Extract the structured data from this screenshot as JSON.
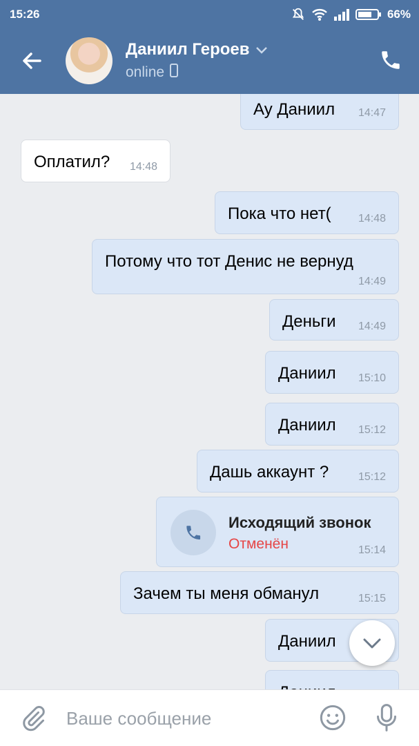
{
  "status_bar": {
    "time": "15:26",
    "battery": "66%"
  },
  "header": {
    "name": "Даниил Героев",
    "status": "online"
  },
  "messages": [
    {
      "text": "Ау Даниил",
      "time": "14:47",
      "dir": "out"
    },
    {
      "text": "Оплатил?",
      "time": "14:48",
      "dir": "in"
    },
    {
      "text": "Пока что нет(",
      "time": "14:48",
      "dir": "out"
    },
    {
      "text": "Потому что тот Денис не вернуд",
      "time": "14:49",
      "dir": "out"
    },
    {
      "text": "Деньги",
      "time": "14:49",
      "dir": "out"
    },
    {
      "text": "Даниил",
      "time": "15:10",
      "dir": "out"
    },
    {
      "text": "Даниил",
      "time": "15:12",
      "dir": "out"
    },
    {
      "text": "Дашь аккаунт ?",
      "time": "15:12",
      "dir": "out"
    },
    {
      "text": "Зачем ты меня обманул",
      "time": "15:15",
      "dir": "out"
    },
    {
      "text": "Даниил",
      "time": "",
      "dir": "out"
    },
    {
      "text": "Даниил",
      "time": "",
      "dir": "out"
    }
  ],
  "call": {
    "title": "Исходящий звонок",
    "status": "Отменён",
    "time": "15:14"
  },
  "composer": {
    "placeholder": "Ваше сообщение"
  },
  "colors": {
    "header": "#4e74a3",
    "outgoing_bubble": "#dbe7f7",
    "incoming_bubble": "#ffffff",
    "background": "#ebedf0",
    "cancelled": "#e64646"
  }
}
